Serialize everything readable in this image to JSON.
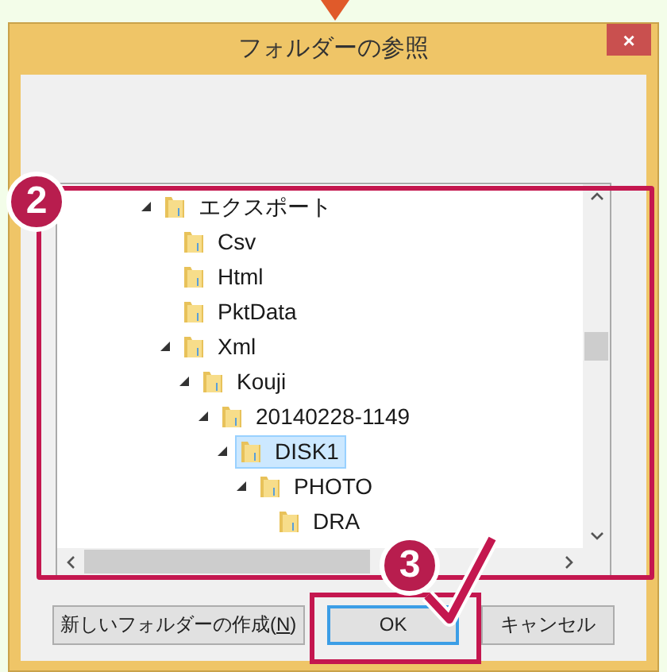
{
  "window": {
    "title": "フォルダーの参照",
    "close": "×"
  },
  "tree": [
    {
      "label": "エクスポート",
      "expanded": true,
      "selected": false,
      "children": [
        {
          "label": "Csv",
          "selected": false
        },
        {
          "label": "Html",
          "selected": false
        },
        {
          "label": "PktData",
          "selected": false
        },
        {
          "label": "Xml",
          "expanded": true,
          "selected": false,
          "children": [
            {
              "label": "Kouji",
              "expanded": true,
              "selected": false,
              "children": [
                {
                  "label": "20140228-1149",
                  "expanded": true,
                  "selected": false,
                  "children": [
                    {
                      "label": "DISK1",
                      "expanded": true,
                      "selected": true,
                      "children": [
                        {
                          "label": "PHOTO",
                          "expanded": true,
                          "selected": false,
                          "children": [
                            {
                              "label": "DRA",
                              "selected": false
                            }
                          ]
                        }
                      ]
                    }
                  ]
                }
              ]
            }
          ]
        }
      ]
    }
  ],
  "buttons": [
    {
      "label": "新しいフォルダーの作成(",
      "mnemonic": "N",
      "suffix": ")",
      "default": false
    },
    {
      "label": "OK",
      "default": true
    },
    {
      "label": "キャンセル",
      "default": false
    }
  ],
  "annotations": [
    {
      "number": "2"
    },
    {
      "number": "3"
    }
  ]
}
